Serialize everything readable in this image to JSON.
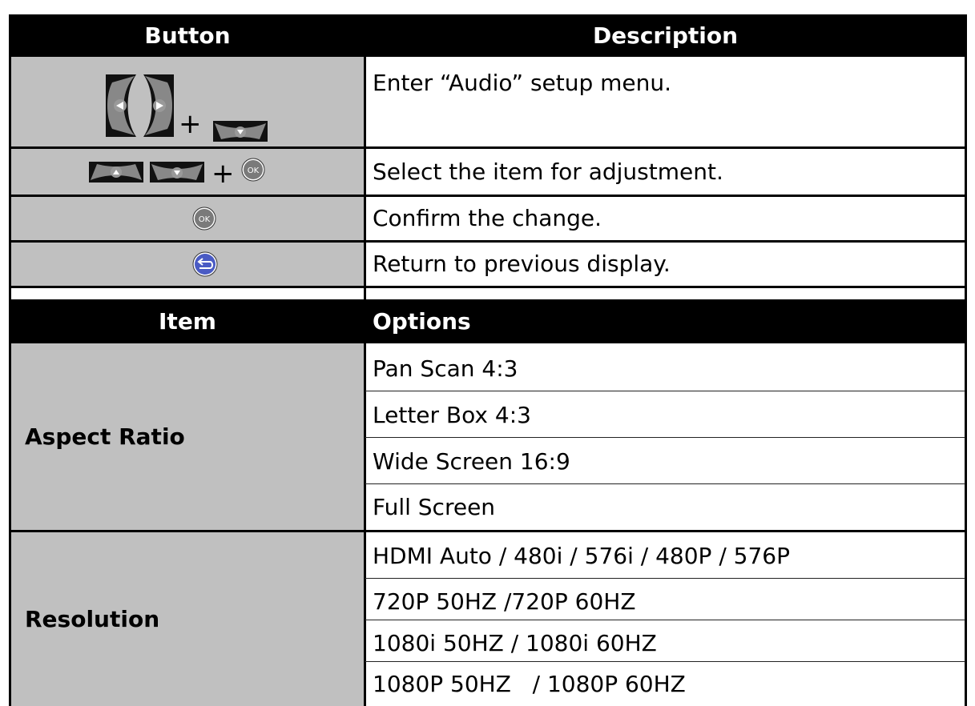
{
  "button_table": {
    "headers": {
      "button": "Button",
      "description": "Description"
    },
    "rows": [
      {
        "icons": [
          "left-arrow-icon",
          "right-arrow-icon",
          "down-arrow-icon"
        ],
        "plus": "+",
        "description": "Enter “Audio” setup menu."
      },
      {
        "icons": [
          "up-arrow-icon",
          "down-arrow-icon",
          "ok-icon"
        ],
        "plus": "+",
        "description": "Select the item for adjustment."
      },
      {
        "icons": [
          "ok-icon"
        ],
        "description": "Confirm the change."
      },
      {
        "icons": [
          "return-icon"
        ],
        "description": "Return to previous display."
      }
    ]
  },
  "options_table": {
    "headers": {
      "item": "Item",
      "options": "Options"
    },
    "rows": [
      {
        "item": "Aspect Ratio",
        "options": [
          "Pan Scan 4:3",
          "Letter Box 4:3",
          "Wide Screen 16:9",
          "Full Screen"
        ]
      },
      {
        "item": "Resolution",
        "options": [
          "HDMI Auto / 480i / 576i / 480P / 576P",
          "720P 50HZ /720P 60HZ",
          "1080i 50HZ / 1080i 60HZ",
          "1080P 50HZ   / 1080P 60HZ"
        ]
      }
    ]
  },
  "icon_labels": {
    "ok": "OK"
  },
  "colors": {
    "header_bg": "#000000",
    "button_cell_bg": "#c0c0c0",
    "return_button": "#4a5bc4",
    "ok_button": "#7a7a7a"
  }
}
